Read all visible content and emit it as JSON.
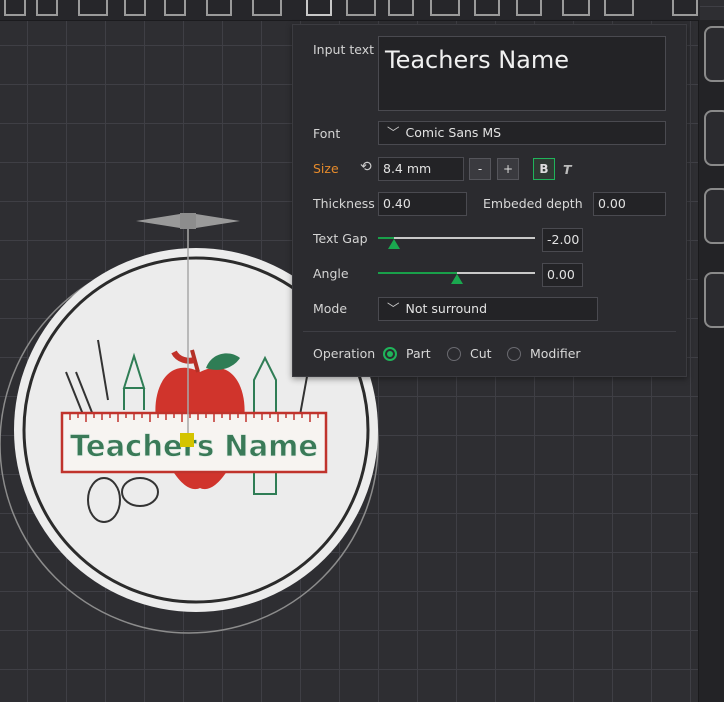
{
  "panel": {
    "input_text_label": "Input text",
    "input_text_value": "Teachers Name",
    "font_label": "Font",
    "font_value": "Comic Sans MS",
    "size_label": "Size",
    "size_value": "8.4 mm",
    "minus_label": "-",
    "plus_label": "+",
    "bold_label": "B",
    "italic_label": "T",
    "thickness_label": "Thickness",
    "thickness_value": "0.40",
    "embedded_depth_label": "Embeded depth",
    "embedded_depth_value": "0.00",
    "text_gap_label": "Text Gap",
    "text_gap_value": "-2.00",
    "text_gap_fraction": 0.1,
    "angle_label": "Angle",
    "angle_value": "0.00",
    "angle_fraction": 0.5,
    "mode_label": "Mode",
    "mode_value": "Not surround",
    "operation_label": "Operation",
    "operation_options": [
      "Part",
      "Cut",
      "Modifier"
    ],
    "operation_selected": "Part"
  },
  "model": {
    "ruler_text": "Teachers Name"
  },
  "colors": {
    "accent_green": "#1fb45a",
    "size_label_orange": "#e58a2b",
    "apple_red": "#d0342c",
    "text_green": "#3a7a58"
  }
}
